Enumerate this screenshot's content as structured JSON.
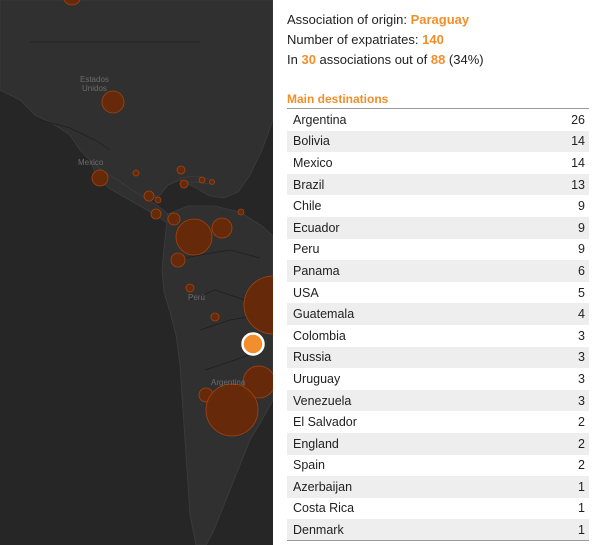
{
  "map": {
    "labels": {
      "usa": "Estados\nUnidos",
      "mexico": "Mexico",
      "peru": "Perú",
      "argentina": "Argentina"
    },
    "colors": {
      "background": "#262626",
      "bubble_fill": "#6b2a08",
      "bubble_stroke": "#a3440f",
      "selected": "#f28e2b"
    }
  },
  "info": {
    "origin_label": "Association of origin: ",
    "origin_value": "Paraguay",
    "expatriates_label": "Number of expatriates: ",
    "expatriates_value": "140",
    "assoc_prefix": "In ",
    "assoc_count": "30",
    "assoc_middle": " associations out of ",
    "assoc_total": "88",
    "assoc_pct": " (34%)"
  },
  "destinations": {
    "heading": "Main destinations",
    "rows": [
      {
        "country": "Argentina",
        "count": "26"
      },
      {
        "country": "Bolivia",
        "count": "14"
      },
      {
        "country": "Mexico",
        "count": "14"
      },
      {
        "country": "Brazil",
        "count": "13"
      },
      {
        "country": "Chile",
        "count": "9"
      },
      {
        "country": "Ecuador",
        "count": "9"
      },
      {
        "country": "Peru",
        "count": "9"
      },
      {
        "country": "Panama",
        "count": "6"
      },
      {
        "country": "USA",
        "count": "5"
      },
      {
        "country": "Guatemala",
        "count": "4"
      },
      {
        "country": "Colombia",
        "count": "3"
      },
      {
        "country": "Russia",
        "count": "3"
      },
      {
        "country": "Uruguay",
        "count": "3"
      },
      {
        "country": "Venezuela",
        "count": "3"
      },
      {
        "country": "El Salvador",
        "count": "2"
      },
      {
        "country": "England",
        "count": "2"
      },
      {
        "country": "Spain",
        "count": "2"
      },
      {
        "country": "Azerbaijan",
        "count": "1"
      },
      {
        "country": "Costa Rica",
        "count": "1"
      },
      {
        "country": "Denmark",
        "count": "1"
      }
    ]
  }
}
